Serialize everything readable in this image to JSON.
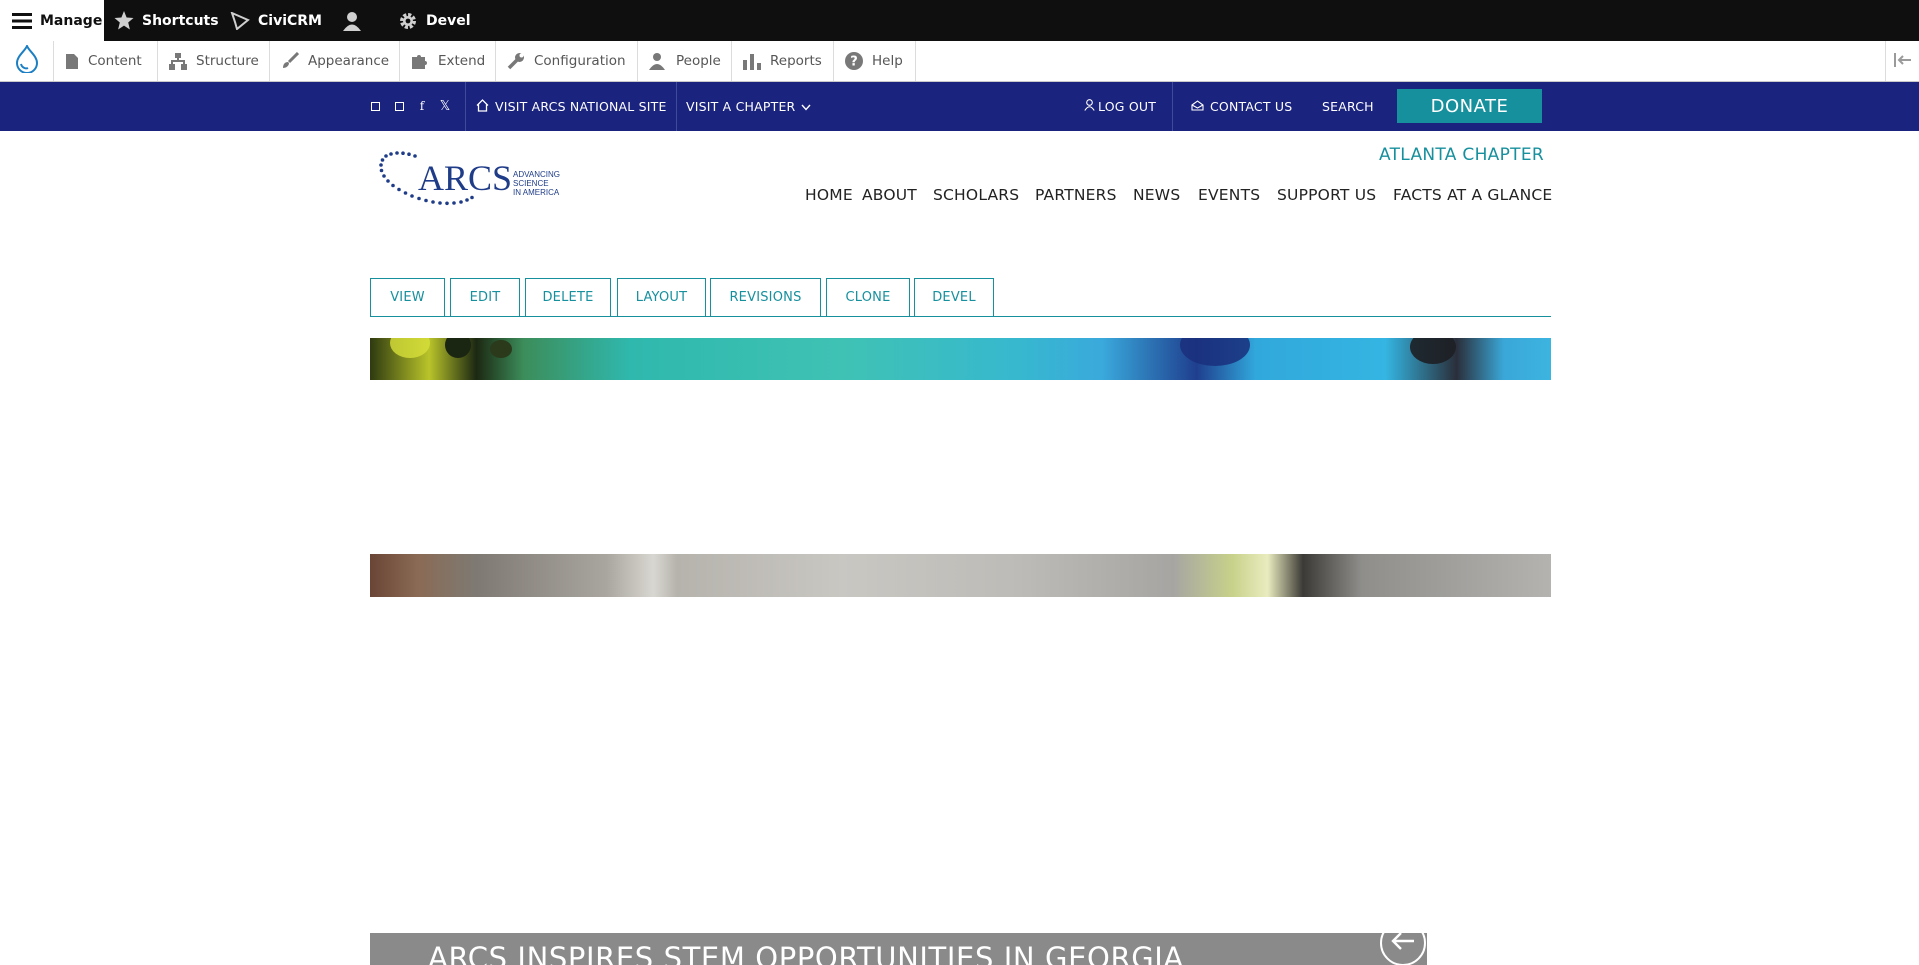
{
  "admin_toolbar": {
    "manage": "Manage",
    "shortcuts": "Shortcuts",
    "civicrm": "CiviCRM",
    "devel": "Devel"
  },
  "admin_tray": {
    "items": [
      "Content",
      "Structure",
      "Appearance",
      "Extend",
      "Configuration",
      "People",
      "Reports",
      "Help"
    ]
  },
  "utility_nav": {
    "visit_national": "VISIT ARCS NATIONAL SITE",
    "visit_chapter": "VISIT A CHAPTER",
    "log_out": "LOG OUT",
    "contact_us": "CONTACT US",
    "search": "SEARCH",
    "donate": "DONATE"
  },
  "header": {
    "logo_text": "ARCS",
    "logo_tagline": [
      "ADVANCING",
      "SCIENCE",
      "IN AMERICA"
    ],
    "chapter": "ATLANTA CHAPTER",
    "nav": [
      "HOME",
      "ABOUT",
      "SCHOLARS",
      "PARTNERS",
      "NEWS",
      "EVENTS",
      "SUPPORT US",
      "FACTS AT A GLANCE"
    ]
  },
  "tabs": [
    "VIEW",
    "EDIT",
    "DELETE",
    "LAYOUT",
    "REVISIONS",
    "CLONE",
    "DEVEL"
  ],
  "slide": {
    "caption": "ARCS INSPIRES STEM OPPORTUNITIES IN GEORGIA"
  },
  "colors": {
    "toolbar_bg": "#0f0f0f",
    "utility_bg": "#1a237e",
    "accent_teal": "#17909e",
    "caption_bg": "#8a8a8a",
    "logo_blue": "#1f3c88"
  }
}
